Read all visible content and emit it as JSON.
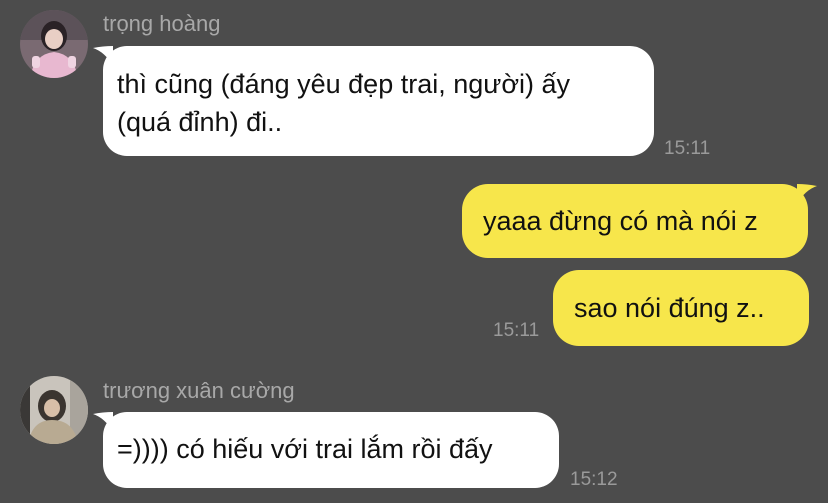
{
  "theme": {
    "background": "#4c4c4c",
    "incoming_bubble": "#ffffff",
    "outgoing_bubble": "#f7e64b",
    "meta_text": "#a8a8a8"
  },
  "messages": [
    {
      "sender": "trọng hoàng",
      "avatar": "avatar-photo-pink",
      "lines": [
        "thì cũng (đáng yêu đẹp trai, người) ấy",
        "(quá đỉnh) đi.."
      ],
      "time": "15:11"
    },
    {
      "outgoing": true,
      "lines": [
        "yaaa đừng có mà nói z"
      ]
    },
    {
      "outgoing": true,
      "lines": [
        "sao nói đúng z.."
      ],
      "time": "15:11"
    },
    {
      "sender": "trương xuân cường",
      "avatar": "avatar-photo-hoodie",
      "lines": [
        "=)))) có hiếu với trai lắm rồi đấy"
      ],
      "time": "15:12"
    }
  ]
}
